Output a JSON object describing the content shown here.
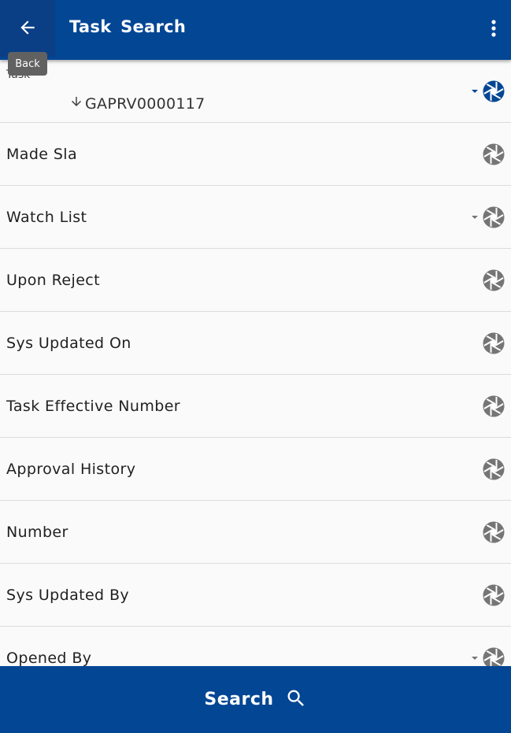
{
  "toolbar": {
    "title": "Task  Search",
    "back_tooltip": "Back",
    "back_icon": "arrow-back-icon",
    "more_icon": "more-vert-icon"
  },
  "colors": {
    "primary": "#034694",
    "icon_gray": "#757575",
    "tooltip_bg": "#616161"
  },
  "fields": [
    {
      "label": "Task",
      "value": "GAPRV0000117",
      "has_dropdown": true,
      "active": true
    },
    {
      "label": "Made Sla",
      "has_dropdown": false,
      "active": false
    },
    {
      "label": "Watch List",
      "has_dropdown": true,
      "active": false
    },
    {
      "label": "Upon Reject",
      "has_dropdown": false,
      "active": false
    },
    {
      "label": "Sys Updated On",
      "has_dropdown": false,
      "active": false
    },
    {
      "label": "Task Effective Number",
      "has_dropdown": false,
      "active": false
    },
    {
      "label": "Approval History",
      "has_dropdown": false,
      "active": false
    },
    {
      "label": "Number",
      "has_dropdown": false,
      "active": false
    },
    {
      "label": "Sys Updated By",
      "has_dropdown": false,
      "active": false
    },
    {
      "label": "Opened By",
      "has_dropdown": true,
      "active": false
    }
  ],
  "footer": {
    "search_label": "Search",
    "search_icon": "search-icon"
  }
}
